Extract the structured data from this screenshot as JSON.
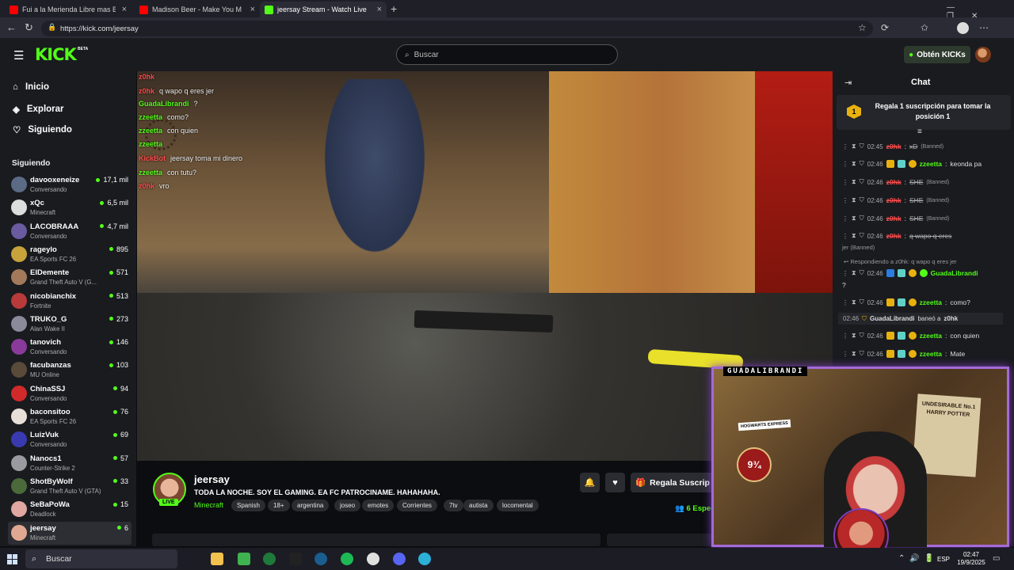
{
  "browser": {
    "tabs": [
      {
        "title": "Fui a la Merienda Libre mas Barat",
        "favicon_color": "#ff0000",
        "active": false
      },
      {
        "title": "Madison Beer - Make You M",
        "favicon_color": "#ff0000",
        "active": false
      },
      {
        "title": "jeersay Stream - Watch Live",
        "favicon_color": "#53fc18",
        "active": true
      }
    ],
    "url": "https://kick.com/jeersay"
  },
  "header": {
    "logo": "KICK",
    "logo_badge": "BETA",
    "search_placeholder": "Buscar",
    "kicks_button": "Obtén KICKs"
  },
  "sidebar": {
    "nav": [
      {
        "label": "Inicio",
        "icon": "home-icon"
      },
      {
        "label": "Explorar",
        "icon": "compass-icon"
      },
      {
        "label": "Siguiendo",
        "icon": "heart-icon"
      }
    ],
    "following_title": "Siguiendo",
    "channels": [
      {
        "name": "davooxeneize",
        "category": "Conversando",
        "viewers": "17,1 mil",
        "color": "#5b6b85"
      },
      {
        "name": "xQc",
        "category": "Minecraft",
        "viewers": "6,5 mil",
        "color": "#dddddd"
      },
      {
        "name": "LACOBRAAA",
        "category": "Conversando",
        "viewers": "4,7 mil",
        "color": "#6a5aa0"
      },
      {
        "name": "rageylo",
        "category": "EA Sports FC 26",
        "viewers": "895",
        "color": "#c8a23a"
      },
      {
        "name": "ElDemente",
        "category": "Grand Theft Auto V (G...",
        "viewers": "571",
        "color": "#a27a5a"
      },
      {
        "name": "nicobianchix",
        "category": "Fortnite",
        "viewers": "513",
        "color": "#b83a3a"
      },
      {
        "name": "TRUKO_G",
        "category": "Alan Wake II",
        "viewers": "273",
        "color": "#8a8a9a"
      },
      {
        "name": "tanovich",
        "category": "Conversando",
        "viewers": "146",
        "color": "#8a3a9a"
      },
      {
        "name": "facubanzas",
        "category": "MU Online",
        "viewers": "103",
        "color": "#5a4a3a"
      },
      {
        "name": "ChinaSSJ",
        "category": "Conversando",
        "viewers": "94",
        "color": "#d02a2a"
      },
      {
        "name": "baconsitoo",
        "category": "EA Sports FC 26",
        "viewers": "76",
        "color": "#e8e0d8"
      },
      {
        "name": "LuizVuk",
        "category": "Conversando",
        "viewers": "69",
        "color": "#3a3ab0"
      },
      {
        "name": "Nanocs1",
        "category": "Counter-Strike 2",
        "viewers": "57",
        "color": "#9a9aa0"
      },
      {
        "name": "ShotByWolf",
        "category": "Grand Theft Auto V (GTA)",
        "viewers": "33",
        "color": "#4a6a3a"
      },
      {
        "name": "SeBaPoWa",
        "category": "Deadlock",
        "viewers": "15",
        "color": "#e0a8a0"
      },
      {
        "name": "jeersay",
        "category": "Minecraft",
        "viewers": "6",
        "color": "#e0a890",
        "selected": true
      }
    ]
  },
  "overlay_chat": [
    {
      "user": "z0hk",
      "text": "",
      "color": "#ff4d4d"
    },
    {
      "user": "z0hk",
      "text": "q wapo q eres jer",
      "color": "#ff4d4d"
    },
    {
      "user": "GuadaLibrandi",
      "text": "?",
      "color": "#53fc18"
    },
    {
      "user": "zzeetta",
      "text": "como?",
      "color": "#53fc18"
    },
    {
      "user": "zzeetta",
      "text": "con quien",
      "color": "#53fc18"
    },
    {
      "user": "zzeetta",
      "text": "",
      "color": "#53fc18"
    },
    {
      "user": "KickBot",
      "text": "jeersay toma mi dinero",
      "color": "#ff4d4d"
    },
    {
      "user": "zzeetta",
      "text": "con tutu?",
      "color": "#53fc18"
    },
    {
      "user": "z0hk",
      "text": "vro",
      "color": "#ff4d4d"
    }
  ],
  "stream": {
    "streamer": "jeersay",
    "live_badge": "LIVE",
    "title": "TODA LA NOCHE. SOY EL GAMING. EA FC PATROCINAME. HAHAHAHA.",
    "category": "Minecraft",
    "tags": [
      "Spanish",
      "18+",
      "argentina",
      "joseo",
      "emotes",
      "Corrientes",
      "7tv",
      "autista",
      "locomental"
    ],
    "gift_button": "Regala Suscrip",
    "viewers": "6 Espec"
  },
  "chat": {
    "title": "Chat",
    "pinned_text": "Regala 1 suscripción para tomar la posición 1",
    "pinned_rank": "1",
    "messages": [
      {
        "time": "02:45",
        "user": "z0hk",
        "text": "xD",
        "banned": "(Banned)",
        "color": "#ff4d4d",
        "struck": true
      },
      {
        "time": "02:46",
        "user": "zzeetta",
        "text": "keonda pa",
        "banned": "",
        "color": "#53fc18",
        "struck": false
      },
      {
        "time": "02:46",
        "user": "z0hk",
        "text": "SHE",
        "banned": "(Banned)",
        "color": "#ff4d4d",
        "struck": true
      },
      {
        "time": "02:46",
        "user": "z0hk",
        "text": "SHE",
        "banned": "(Banned)",
        "color": "#ff4d4d",
        "struck": true
      },
      {
        "time": "02:46",
        "user": "z0hk",
        "text": "SHE",
        "banned": "(Banned)",
        "color": "#ff4d4d",
        "struck": true
      },
      {
        "time": "02:46",
        "user": "z0hk",
        "text": "q wapo q eres",
        "banned": "",
        "color": "#ff4d4d",
        "struck": true
      }
    ],
    "wrapped_ban": "jer (Banned)",
    "reply_to": "Respondiendo a z0hk: q wapo q eres jer",
    "reply_msg": {
      "time": "02:46",
      "user": "GuadaLibrandi",
      "text": "?",
      "color": "#53fc18"
    },
    "msg_como": {
      "time": "02:46",
      "user": "zzeetta",
      "text": "como?",
      "color": "#53fc18"
    },
    "mod_event": {
      "time": "02:46",
      "actor": "GuadaLibrandi",
      "action": "baneó a",
      "target": "z0hk"
    },
    "msg_quien": {
      "time": "02:46",
      "user": "zzeetta",
      "text": "con quien",
      "color": "#53fc18"
    },
    "msg_mate": {
      "time": "02:46",
      "user": "zzeetta",
      "text": "Mate",
      "color": "#53fc18"
    }
  },
  "webcam": {
    "label": "GUADALIBRANDI",
    "poster_text": "UNDESIRABLE No.1 HARRY POTTER",
    "platform_text": "9¾",
    "hogwarts_text": "HOGWARTS EXPRESS"
  },
  "taskbar": {
    "search_placeholder": "Buscar",
    "lang": "ESP",
    "time": "02:47",
    "date": "19/9/2025"
  }
}
